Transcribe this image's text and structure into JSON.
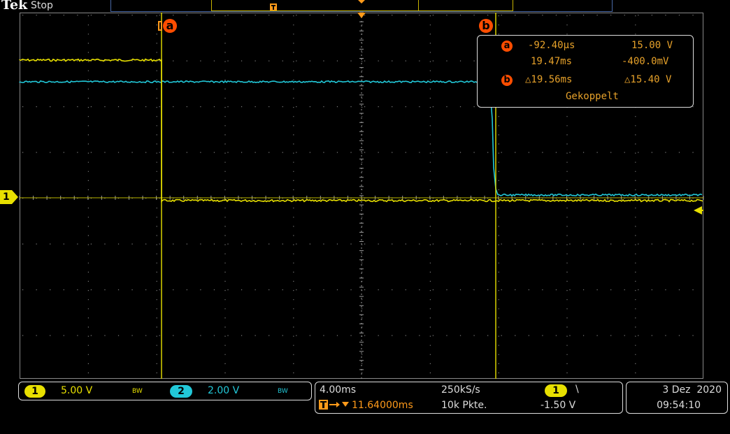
{
  "header": {
    "brand": "Tek",
    "acq_state": "Stop"
  },
  "colors": {
    "ch1": "#e8e000",
    "ch2": "#22c8d8",
    "cursor": "#ff4d00",
    "trigger": "#ff9a1a"
  },
  "cursors": {
    "a_label": "a",
    "b_label": "b"
  },
  "readout": {
    "a_label": "a",
    "a_time": "-92.40µs",
    "a_volt": "15.00 V",
    "b_time": "19.47ms",
    "b_volt": "-400.0mV",
    "b_label": "b",
    "delta_time": "△19.56ms",
    "delta_volt": "△15.40 V",
    "mode": "Gekoppelt"
  },
  "channels": [
    {
      "num": "1",
      "scale": "5.00 V",
      "bw": "BW"
    },
    {
      "num": "2",
      "scale": "2.00 V",
      "bw": "BW"
    }
  ],
  "ch1_marker": "1",
  "timebase": {
    "horizontal": "4.00ms",
    "sample_rate": "250kS/s",
    "record_length": "10k Pkte.",
    "trigger_delay": "11.64000ms",
    "trigger_source": "1",
    "trigger_slope": "\\",
    "trigger_level": "-1.50 V"
  },
  "datetime": {
    "date": "3 Dez  2020",
    "time": "09:54:10"
  }
}
